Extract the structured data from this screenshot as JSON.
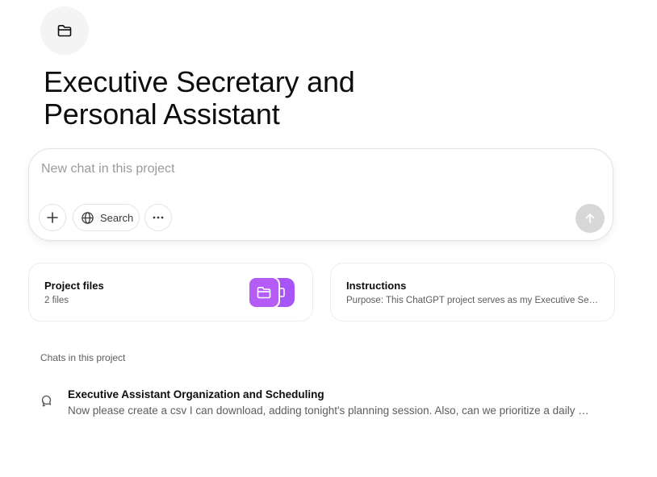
{
  "project": {
    "icon": "folder-icon",
    "title": "Executive Secretary and Personal Assistant"
  },
  "composer": {
    "placeholder": "New chat in this project",
    "value": "",
    "add_icon": "plus-icon",
    "search_label": "Search",
    "search_icon": "globe-icon",
    "more_icon": "ellipsis-icon",
    "send_icon": "arrow-up-icon"
  },
  "cards": {
    "files": {
      "title": "Project files",
      "subtitle": "2 files",
      "accent": "#a855f7"
    },
    "instructions": {
      "title": "Instructions",
      "subtitle": "Purpose: This ChatGPT project serves as my Executive Sec…"
    }
  },
  "chats": {
    "heading": "Chats in this project",
    "items": [
      {
        "title": "Executive Assistant Organization and Scheduling",
        "preview": "Now please create a csv I can download, adding tonight's planning session. Also, can we prioritize a daily …",
        "icon": "chat-bubbles-icon"
      }
    ]
  }
}
